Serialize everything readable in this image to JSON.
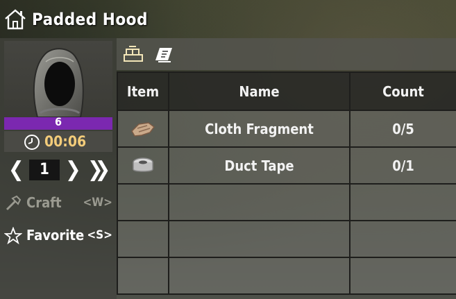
{
  "header": {
    "title": "Padded Hood",
    "home_icon": "house-icon"
  },
  "left_panel": {
    "item_icon": "padded-hood-icon",
    "quality_value": "6",
    "quality_color": "#7b28b0",
    "timer_icon": "clock-icon",
    "craft_time": "00:06",
    "quantity": "1",
    "decrease_glyph": "❮",
    "increase_glyph": "❯",
    "max_glyph": "❯❯",
    "craft": {
      "label": "Craft",
      "hotkey": "<W>",
      "icon": "hammer-icon"
    },
    "favorite": {
      "label": "Favorite",
      "hotkey": "<S>",
      "icon": "star-icon"
    }
  },
  "tabs": [
    {
      "icon": "workstation-icon"
    },
    {
      "icon": "recipe-book-icon"
    }
  ],
  "table": {
    "headers": [
      "Item",
      "Name",
      "Count"
    ],
    "rows": [
      {
        "icon": "cloth-fragment-icon",
        "name": "Cloth Fragment",
        "count": "0/5"
      },
      {
        "icon": "duct-tape-icon",
        "name": "Duct Tape",
        "count": "0/1"
      },
      {
        "icon": "",
        "name": "",
        "count": ""
      },
      {
        "icon": "",
        "name": "",
        "count": ""
      },
      {
        "icon": "",
        "name": "",
        "count": ""
      }
    ]
  },
  "colors": {
    "timer_text": "#f3cc7a",
    "disabled_text": "#9a9a90"
  }
}
